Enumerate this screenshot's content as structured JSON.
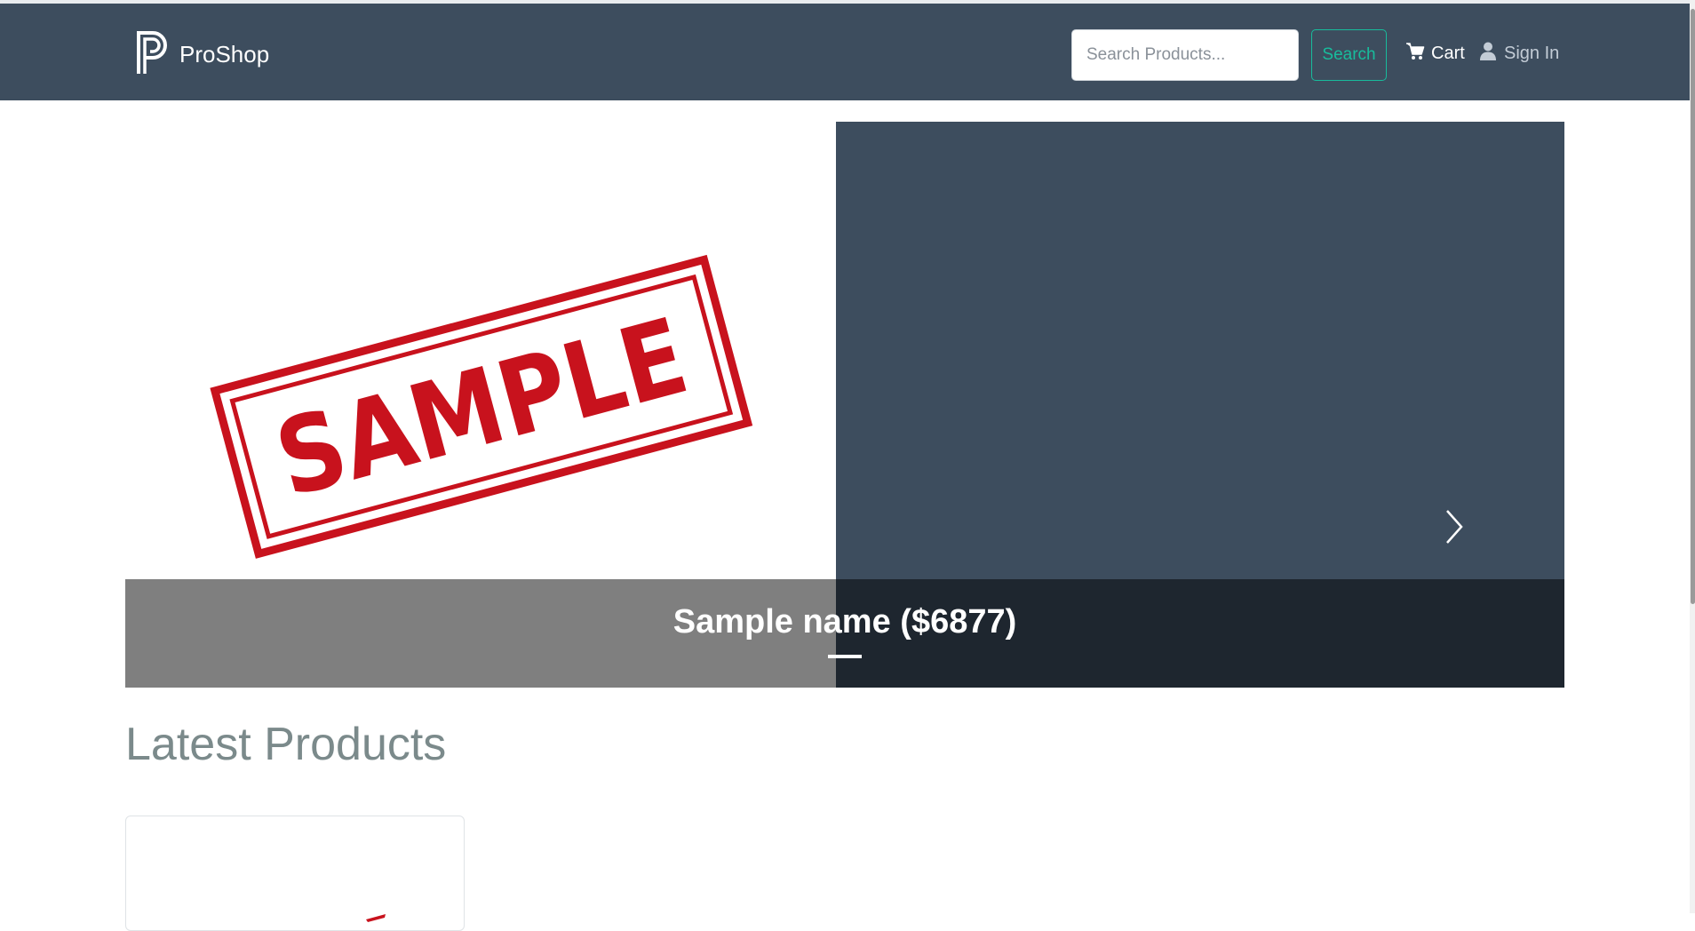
{
  "navbar": {
    "brand_name": "ProShop",
    "search_placeholder": "Search Products...",
    "search_button_label": "Search",
    "cart_label": "Cart",
    "signin_label": "Sign In"
  },
  "carousel": {
    "slide_image_text": "SAMPLE",
    "caption": "Sample name ($6877)",
    "active_slide": 1,
    "slide_count": 1
  },
  "main": {
    "section_title": "Latest Products"
  },
  "colors": {
    "navbar_bg": "#3d4d5e",
    "accent": "#18bc9c",
    "stamp_red": "#c8121d",
    "heading_gray": "#7b8a8b"
  },
  "icons": {
    "brand": "proshop-logo-icon",
    "cart": "shopping-cart-icon",
    "signin": "user-icon",
    "next": "chevron-right-icon"
  }
}
